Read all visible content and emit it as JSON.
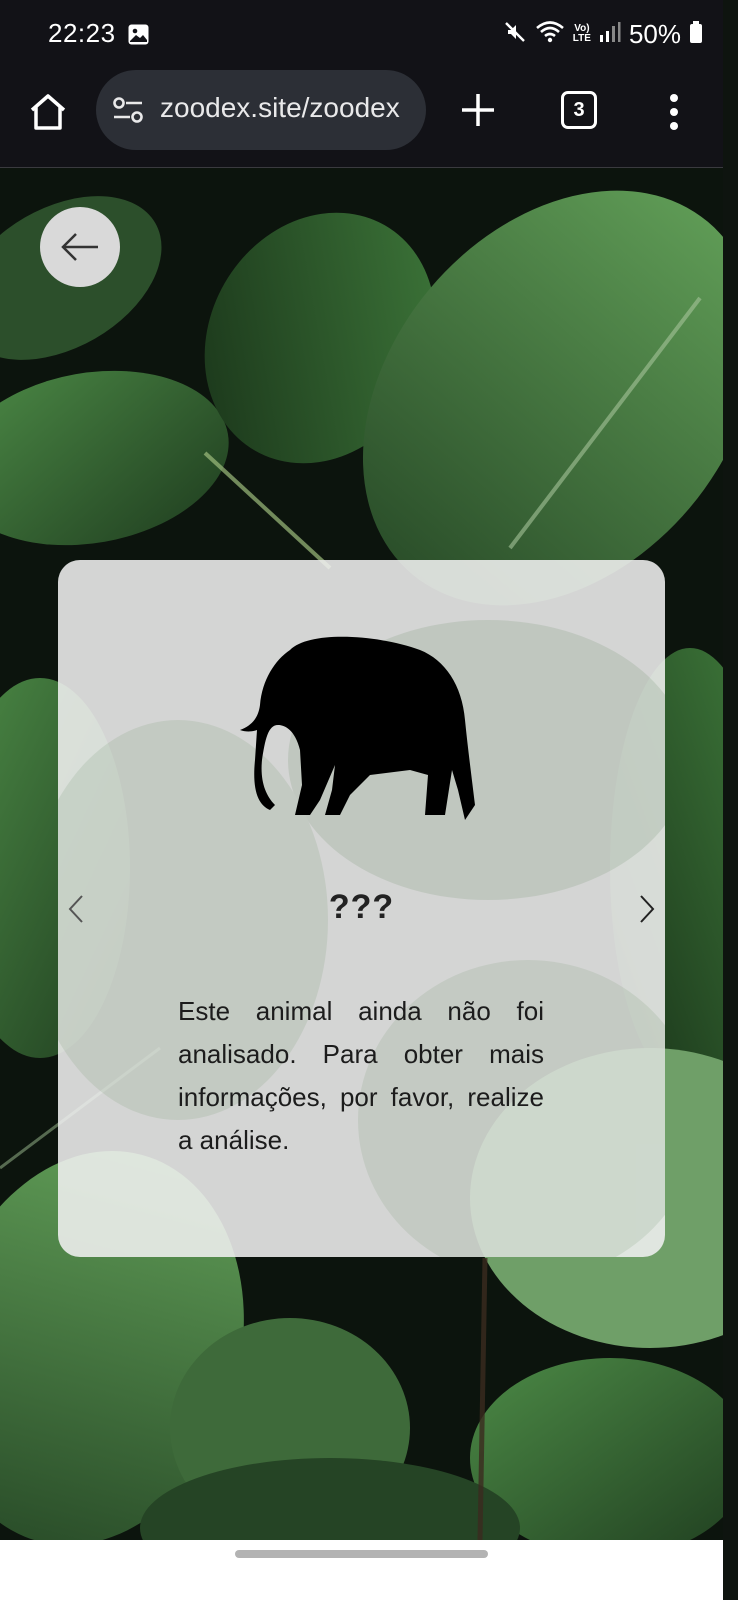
{
  "status_bar": {
    "time": "22:23",
    "battery": "50%",
    "lte_top": "Vo)",
    "lte_bottom": "LTE",
    "icons": [
      "gallery-icon",
      "mute-icon",
      "wifi-icon",
      "volte-icon",
      "signal-icon",
      "battery-icon"
    ]
  },
  "browser": {
    "url": "zoodex.site/zoodex",
    "tab_count": "3",
    "icons": [
      "home-icon",
      "site-settings-icon",
      "plus-icon",
      "tabs-icon",
      "more-vert-icon"
    ]
  },
  "card": {
    "animal_name": "???",
    "description": "Este animal ainda não foi analisado. Para obter mais informações, por favor, realize a análise.",
    "icons": [
      "elephant-silhouette-icon",
      "chevron-left-icon",
      "chevron-right-icon"
    ]
  },
  "page": {
    "icons": [
      "arrow-left-icon"
    ]
  },
  "colors": {
    "status_bar_bg": "#121217",
    "url_pill_bg": "#2c2f36",
    "card_bg": "#f0f0f0",
    "leaf_green": "#2f5a2e",
    "back_button_bg": "#d9d9d9"
  }
}
